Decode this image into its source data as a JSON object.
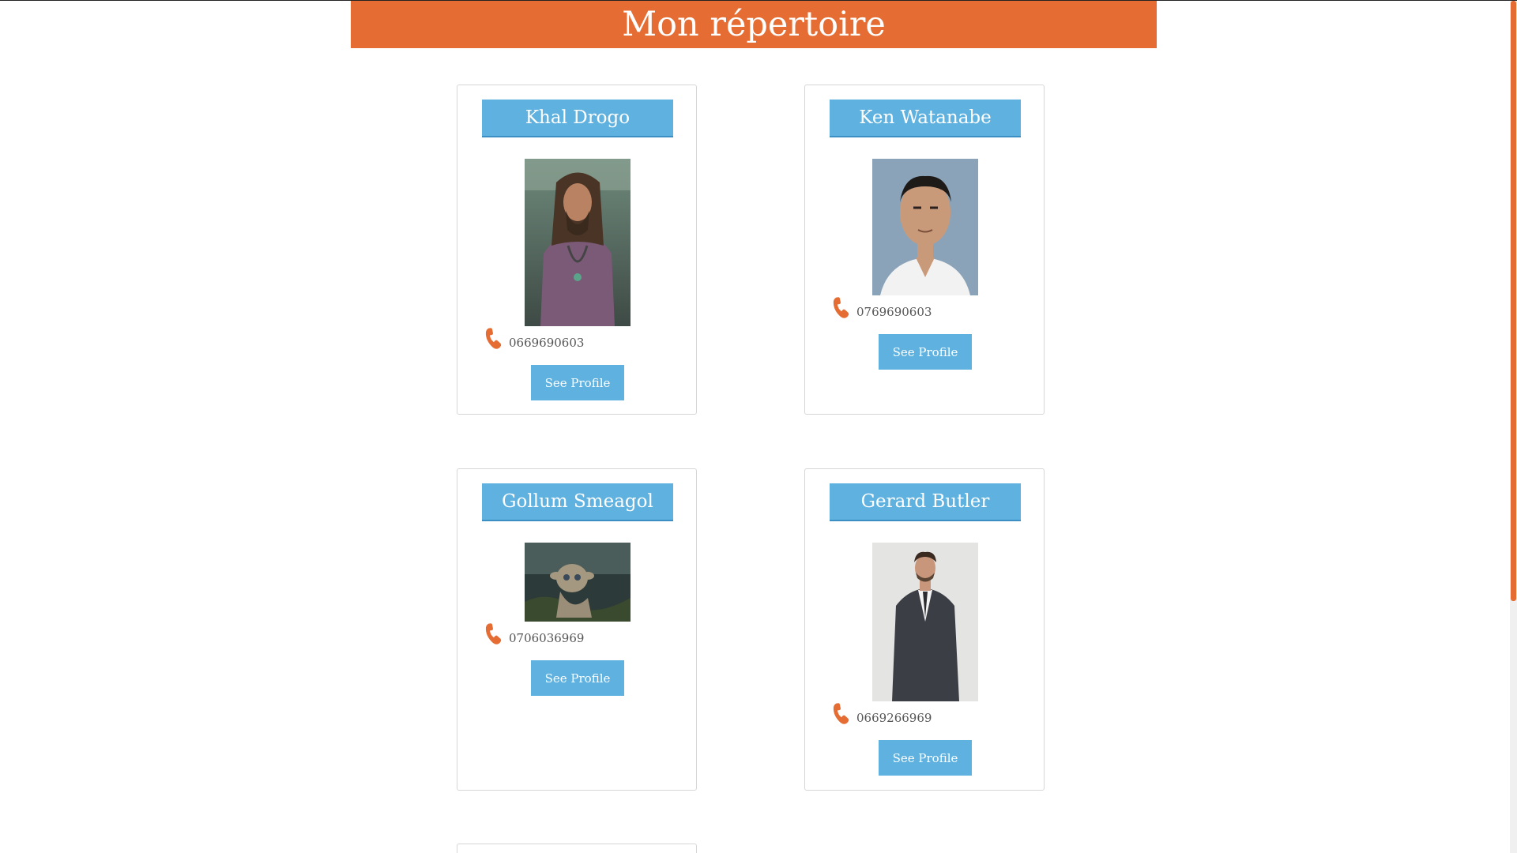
{
  "header": {
    "title": "Mon répertoire"
  },
  "accent_color": "#e56d33",
  "button_color": "#5fb1df",
  "contacts": [
    {
      "name": "Khal Drogo",
      "phone": "0669690603",
      "button_label": "See Profile",
      "phone_icon": "phone-icon"
    },
    {
      "name": "Ken Watanabe",
      "phone": "0769690603",
      "button_label": "See Profile",
      "phone_icon": "phone-icon"
    },
    {
      "name": "Gollum Smeagol",
      "phone": "0706036969",
      "button_label": "See Profile",
      "phone_icon": "phone-icon"
    },
    {
      "name": "Gerard Butler",
      "phone": "0669266969",
      "button_label": "See Profile",
      "phone_icon": "phone-icon"
    }
  ]
}
